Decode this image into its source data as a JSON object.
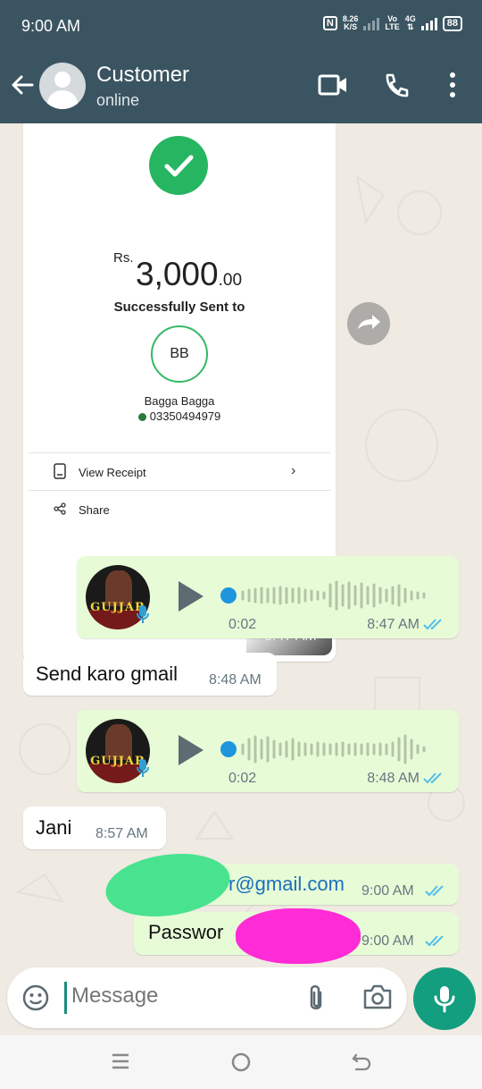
{
  "status_bar": {
    "time": "9:00 AM",
    "nfc": "N",
    "net_speed_value": "8.26",
    "net_speed_unit": "K/S",
    "volte_top": "Vo",
    "volte_bottom": "LTE",
    "network": "4G",
    "battery": "88"
  },
  "header": {
    "contact_name": "Customer",
    "contact_status": "online"
  },
  "receipt": {
    "currency": "Rs.",
    "amount_main": "3,000",
    "amount_decimal": ".00",
    "status_text": "Successfully Sent to",
    "initials": "BB",
    "payee_name": "Bagga Bagga",
    "payee_phone": "03350494979",
    "view_receipt_label": "View Receipt",
    "share_label": "Share",
    "time": "8:47 AM"
  },
  "messages": [
    {
      "type": "voice",
      "direction": "out",
      "avatar_text": "GUJJAR",
      "duration": "0:02",
      "time": "8:47 AM"
    },
    {
      "type": "text",
      "direction": "in",
      "text": "Send karo gmail",
      "time": "8:48 AM"
    },
    {
      "type": "voice",
      "direction": "out",
      "avatar_text": "GUJJAR",
      "duration": "0:02",
      "time": "8:48 AM"
    },
    {
      "type": "text",
      "direction": "in",
      "text": "Jani",
      "time": "8:57 AM"
    },
    {
      "type": "text",
      "direction": "out",
      "text": "r@gmail.com",
      "time": "9:00 AM"
    },
    {
      "type": "text",
      "direction": "out",
      "text": "Passwor",
      "time": "9:00 AM"
    }
  ],
  "input": {
    "placeholder": "Message"
  },
  "colors": {
    "header_bg": "#3b5461",
    "chat_bg": "#efeae2",
    "outgoing_bubble": "#e7fcd6",
    "accent": "#139e7f",
    "read_ticks": "#53bdeb"
  }
}
